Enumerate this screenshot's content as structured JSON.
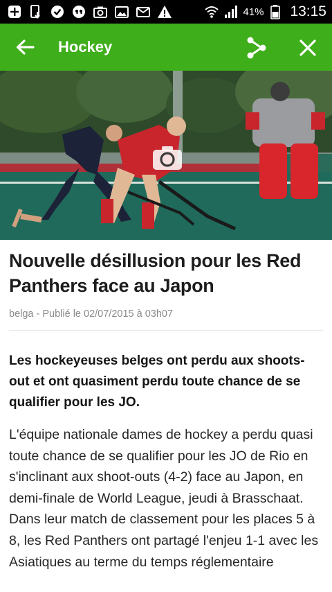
{
  "status_bar": {
    "battery_percent": "41%",
    "time": "13:15"
  },
  "app_bar": {
    "title": "Hockey",
    "accent_color": "#3fae1b"
  },
  "hero": {
    "camera_icon": "camera-icon"
  },
  "article": {
    "headline": "Nouvelle désillusion pour les Red Panthers face au Japon",
    "byline": "belga - Publié le 02/07/2015 à 03h07",
    "lead": "Les hockeyeuses belges ont perdu aux shoots-out et ont quasiment perdu toute chance de se qualifier pour les JO.",
    "body": "L'équipe nationale dames de hockey a perdu quasi toute chance de se qualifier pour les JO de Rio en s'inclinant aux shoot-outs (4-2) face au Japon, en demi-finale de World League, jeudi à Brasschaat. Dans leur match de classement pour les places 5 à 8, les Red Panthers ont partagé l'enjeu 1-1 avec les Asiatiques au terme du temps réglementaire"
  }
}
